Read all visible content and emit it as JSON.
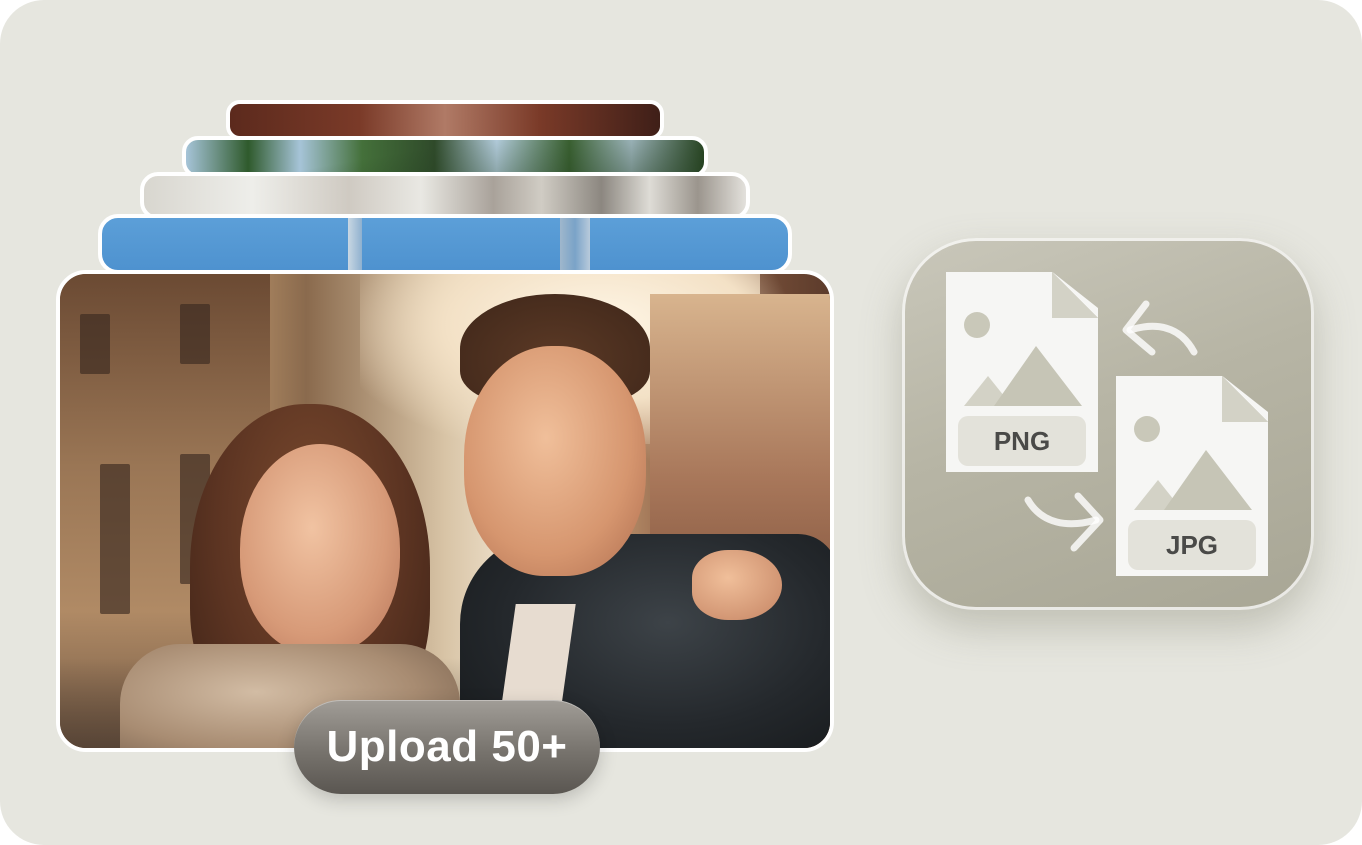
{
  "upload_badge": {
    "label": "Upload 50+"
  },
  "converter": {
    "source_format": "PNG",
    "target_format": "JPG",
    "icons": [
      "image-file-icon",
      "image-file-icon",
      "arrow-back-icon",
      "arrow-forward-icon"
    ]
  },
  "photos": {
    "stack_count": 5,
    "icons": [
      "photo-thumbnail"
    ]
  },
  "colors": {
    "background": "#e6e6df",
    "badge": "#77736d",
    "tile": "#b7b5a5",
    "card_border": "#ffffff",
    "doc_label_text": "#4a4a48"
  }
}
